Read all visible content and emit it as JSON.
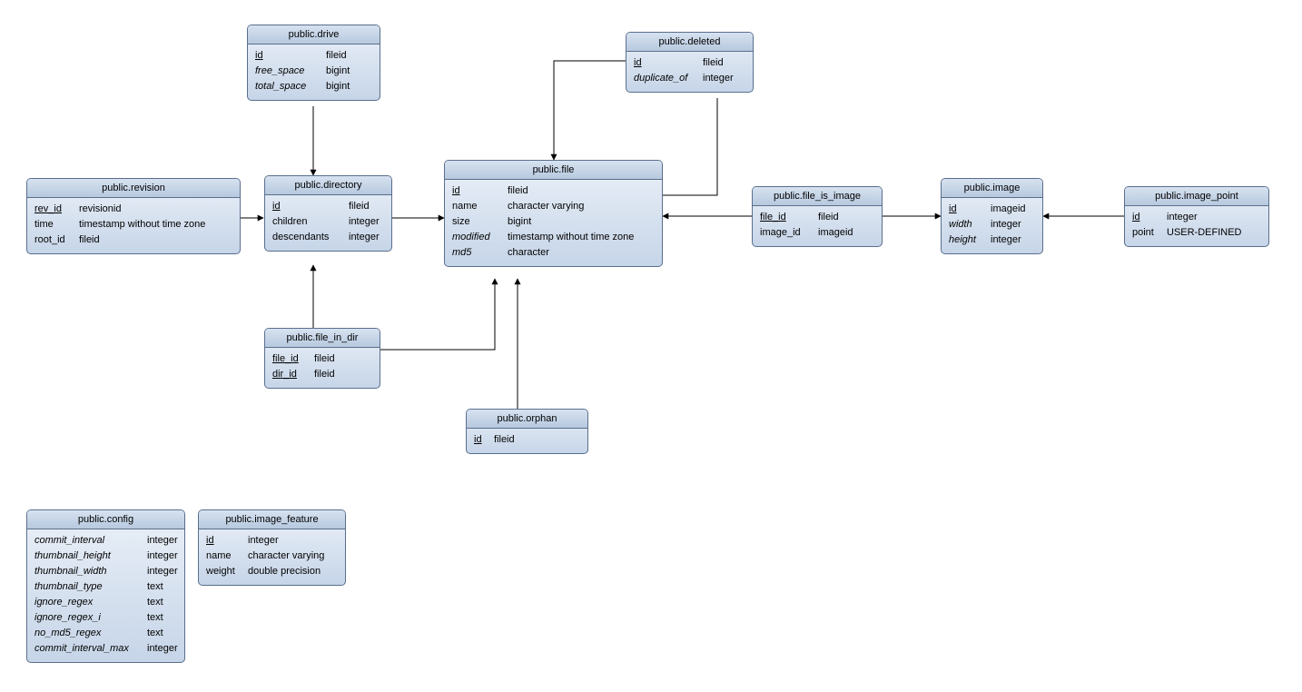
{
  "tables": {
    "drive": {
      "title": "public.drive",
      "cols": [
        {
          "name": "id",
          "type": "fileid",
          "pk": true,
          "it": false
        },
        {
          "name": "free_space",
          "type": "bigint",
          "pk": false,
          "it": true
        },
        {
          "name": "total_space",
          "type": "bigint",
          "pk": false,
          "it": true
        }
      ]
    },
    "deleted": {
      "title": "public.deleted",
      "cols": [
        {
          "name": "id",
          "type": "fileid",
          "pk": true,
          "it": false
        },
        {
          "name": "duplicate_of",
          "type": "integer",
          "pk": false,
          "it": true
        }
      ]
    },
    "revision": {
      "title": "public.revision",
      "cols": [
        {
          "name": "rev_id",
          "type": "revisionid",
          "pk": true,
          "it": false
        },
        {
          "name": "time",
          "type": "timestamp without time zone",
          "pk": false,
          "it": false
        },
        {
          "name": "root_id",
          "type": "fileid",
          "pk": false,
          "it": false
        }
      ]
    },
    "directory": {
      "title": "public.directory",
      "cols": [
        {
          "name": "id",
          "type": "fileid",
          "pk": true,
          "it": false
        },
        {
          "name": "children",
          "type": "integer",
          "pk": false,
          "it": false
        },
        {
          "name": "descendants",
          "type": "integer",
          "pk": false,
          "it": false
        }
      ]
    },
    "file": {
      "title": "public.file",
      "cols": [
        {
          "name": "id",
          "type": "fileid",
          "pk": true,
          "it": false
        },
        {
          "name": "name",
          "type": "character varying",
          "pk": false,
          "it": false
        },
        {
          "name": "size",
          "type": "bigint",
          "pk": false,
          "it": false
        },
        {
          "name": "modified",
          "type": "timestamp without time zone",
          "pk": false,
          "it": true
        },
        {
          "name": "md5",
          "type": "character",
          "pk": false,
          "it": true
        }
      ]
    },
    "file_is_image": {
      "title": "public.file_is_image",
      "cols": [
        {
          "name": "file_id",
          "type": "fileid",
          "pk": true,
          "it": false
        },
        {
          "name": "image_id",
          "type": "imageid",
          "pk": false,
          "it": false
        }
      ]
    },
    "image": {
      "title": "public.image",
      "cols": [
        {
          "name": "id",
          "type": "imageid",
          "pk": true,
          "it": false
        },
        {
          "name": "width",
          "type": "integer",
          "pk": false,
          "it": true
        },
        {
          "name": "height",
          "type": "integer",
          "pk": false,
          "it": true
        }
      ]
    },
    "image_point": {
      "title": "public.image_point",
      "cols": [
        {
          "name": "id",
          "type": "integer",
          "pk": true,
          "it": false
        },
        {
          "name": "point",
          "type": "USER-DEFINED",
          "pk": false,
          "it": false
        }
      ]
    },
    "file_in_dir": {
      "title": "public.file_in_dir",
      "cols": [
        {
          "name": "file_id",
          "type": "fileid",
          "pk": true,
          "it": false
        },
        {
          "name": "dir_id",
          "type": "fileid",
          "pk": true,
          "it": false
        }
      ]
    },
    "orphan": {
      "title": "public.orphan",
      "cols": [
        {
          "name": "id",
          "type": "fileid",
          "pk": true,
          "it": false
        }
      ]
    },
    "config": {
      "title": "public.config",
      "cols": [
        {
          "name": "commit_interval",
          "type": "integer",
          "pk": false,
          "it": true
        },
        {
          "name": "thumbnail_height",
          "type": "integer",
          "pk": false,
          "it": true
        },
        {
          "name": "thumbnail_width",
          "type": "integer",
          "pk": false,
          "it": true
        },
        {
          "name": "thumbnail_type",
          "type": "text",
          "pk": false,
          "it": true
        },
        {
          "name": "ignore_regex",
          "type": "text",
          "pk": false,
          "it": true
        },
        {
          "name": "ignore_regex_i",
          "type": "text",
          "pk": false,
          "it": true
        },
        {
          "name": "no_md5_regex",
          "type": "text",
          "pk": false,
          "it": true
        },
        {
          "name": "commit_interval_max",
          "type": "integer",
          "pk": false,
          "it": true
        }
      ]
    },
    "image_feature": {
      "title": "public.image_feature",
      "cols": [
        {
          "name": "id",
          "type": "integer",
          "pk": true,
          "it": false
        },
        {
          "name": "name",
          "type": "character varying",
          "pk": false,
          "it": false
        },
        {
          "name": "weight",
          "type": "double precision",
          "pk": false,
          "it": false
        }
      ]
    }
  },
  "chart_data": {
    "type": "er-diagram",
    "entities": [
      {
        "name": "public.drive",
        "columns": [
          {
            "name": "id",
            "type": "fileid",
            "pk": true
          },
          {
            "name": "free_space",
            "type": "bigint"
          },
          {
            "name": "total_space",
            "type": "bigint"
          }
        ]
      },
      {
        "name": "public.deleted",
        "columns": [
          {
            "name": "id",
            "type": "fileid",
            "pk": true
          },
          {
            "name": "duplicate_of",
            "type": "integer"
          }
        ]
      },
      {
        "name": "public.revision",
        "columns": [
          {
            "name": "rev_id",
            "type": "revisionid",
            "pk": true
          },
          {
            "name": "time",
            "type": "timestamp without time zone"
          },
          {
            "name": "root_id",
            "type": "fileid"
          }
        ]
      },
      {
        "name": "public.directory",
        "columns": [
          {
            "name": "id",
            "type": "fileid",
            "pk": true
          },
          {
            "name": "children",
            "type": "integer"
          },
          {
            "name": "descendants",
            "type": "integer"
          }
        ]
      },
      {
        "name": "public.file",
        "columns": [
          {
            "name": "id",
            "type": "fileid",
            "pk": true
          },
          {
            "name": "name",
            "type": "character varying"
          },
          {
            "name": "size",
            "type": "bigint"
          },
          {
            "name": "modified",
            "type": "timestamp without time zone"
          },
          {
            "name": "md5",
            "type": "character"
          }
        ]
      },
      {
        "name": "public.file_is_image",
        "columns": [
          {
            "name": "file_id",
            "type": "fileid",
            "pk": true
          },
          {
            "name": "image_id",
            "type": "imageid"
          }
        ]
      },
      {
        "name": "public.image",
        "columns": [
          {
            "name": "id",
            "type": "imageid",
            "pk": true
          },
          {
            "name": "width",
            "type": "integer"
          },
          {
            "name": "height",
            "type": "integer"
          }
        ]
      },
      {
        "name": "public.image_point",
        "columns": [
          {
            "name": "id",
            "type": "integer",
            "pk": true
          },
          {
            "name": "point",
            "type": "USER-DEFINED"
          }
        ]
      },
      {
        "name": "public.file_in_dir",
        "columns": [
          {
            "name": "file_id",
            "type": "fileid",
            "pk": true
          },
          {
            "name": "dir_id",
            "type": "fileid",
            "pk": true
          }
        ]
      },
      {
        "name": "public.orphan",
        "columns": [
          {
            "name": "id",
            "type": "fileid",
            "pk": true
          }
        ]
      },
      {
        "name": "public.config",
        "columns": [
          {
            "name": "commit_interval",
            "type": "integer"
          },
          {
            "name": "thumbnail_height",
            "type": "integer"
          },
          {
            "name": "thumbnail_width",
            "type": "integer"
          },
          {
            "name": "thumbnail_type",
            "type": "text"
          },
          {
            "name": "ignore_regex",
            "type": "text"
          },
          {
            "name": "ignore_regex_i",
            "type": "text"
          },
          {
            "name": "no_md5_regex",
            "type": "text"
          },
          {
            "name": "commit_interval_max",
            "type": "integer"
          }
        ]
      },
      {
        "name": "public.image_feature",
        "columns": [
          {
            "name": "id",
            "type": "integer",
            "pk": true
          },
          {
            "name": "name",
            "type": "character varying"
          },
          {
            "name": "weight",
            "type": "double precision"
          }
        ]
      }
    ],
    "relationships": [
      {
        "from": "public.drive",
        "to": "public.directory"
      },
      {
        "from": "public.revision",
        "to": "public.directory"
      },
      {
        "from": "public.directory",
        "to": "public.file"
      },
      {
        "from": "public.file_in_dir",
        "to": "public.directory"
      },
      {
        "from": "public.file_in_dir",
        "to": "public.file"
      },
      {
        "from": "public.orphan",
        "to": "public.file"
      },
      {
        "from": "public.deleted",
        "to": "public.file",
        "note": "two edges"
      },
      {
        "from": "public.file_is_image",
        "to": "public.file"
      },
      {
        "from": "public.file_is_image",
        "to": "public.image"
      },
      {
        "from": "public.image_point",
        "to": "public.image"
      }
    ]
  }
}
